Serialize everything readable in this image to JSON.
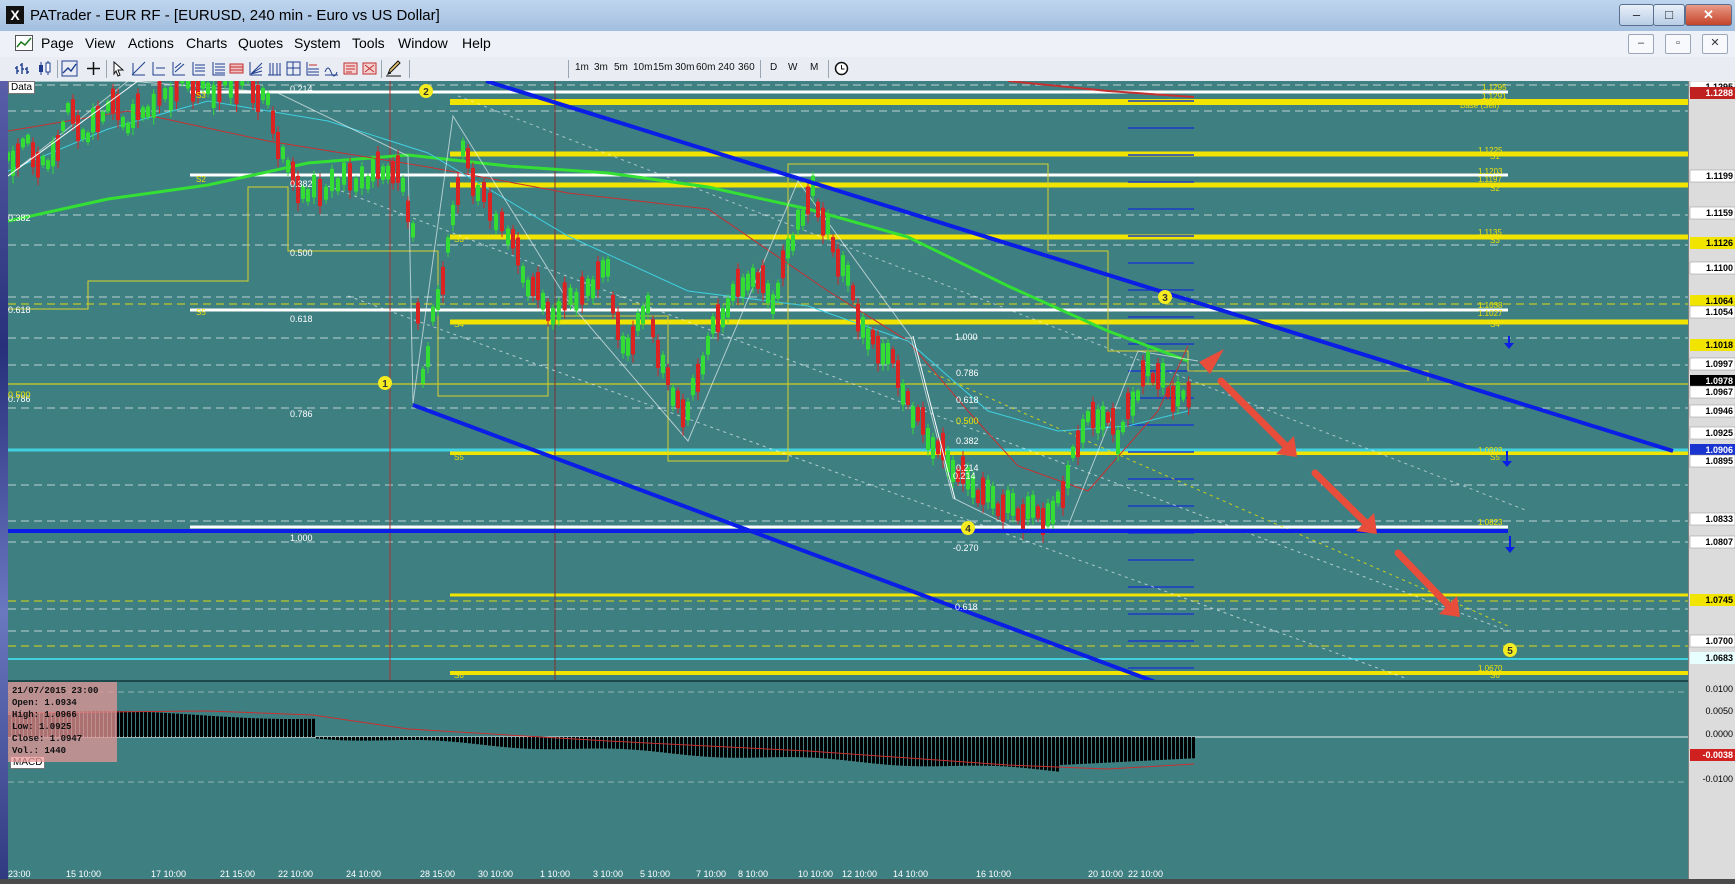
{
  "window": {
    "title": "PATrader - EUR RF - [EURUSD, 240 min - Euro vs US Dollar]",
    "app_icon": "X",
    "controls": [
      "–",
      "□",
      "✕"
    ]
  },
  "menu": {
    "items": [
      "Page",
      "View",
      "Actions",
      "Charts",
      "Quotes",
      "System",
      "Tools",
      "Window",
      "Help"
    ],
    "mdi_controls": [
      "–",
      "▫",
      "✕"
    ]
  },
  "toolbar": {
    "timeframes": [
      "1m",
      "3m",
      "5m",
      "10m",
      "15m",
      "30m",
      "60m",
      "240",
      "360",
      "D",
      "W",
      "M"
    ]
  },
  "chart": {
    "data_label": "Data",
    "macd_label": "MACD",
    "info_panel": {
      "date": "21/07/2015 23:00",
      "open": "Open: 1.0934",
      "high": "High: 1.0966",
      "low": "Low: 1.0925",
      "close": "Close: 1.0947",
      "vol": "Vol.: 1440"
    },
    "wave_labels": [
      "1",
      "2",
      "3",
      "4",
      "5"
    ],
    "fib_labels": [
      "0.214",
      "0.382",
      "0.500",
      "0.618",
      "0.786",
      "1.000",
      "0.618",
      "0.786",
      "0.500",
      "0.382",
      "0.214",
      "-0.270",
      "0.618",
      "1.000"
    ],
    "pivot_labels": [
      "S3",
      "S2",
      "S3",
      "S5",
      "S4",
      "S5",
      "S6",
      "S1",
      "S2",
      "S3",
      "S4",
      "S5",
      "S6"
    ],
    "level_labels": [
      "1.1295",
      "1.1291",
      "Base (Sell)",
      "1.1225",
      "1.1203",
      "1.1197",
      "1.1135",
      "1.1038",
      "1.1027",
      "1.0903",
      "1.0823",
      "1.0670"
    ],
    "price_axis": [
      "1.1295",
      "1.1288",
      "1.1199",
      "1.1159",
      "1.1126",
      "1.1100",
      "1.1064",
      "1.1054",
      "1.1018",
      "1.0997",
      "1.0978",
      "1.0967",
      "1.0946",
      "1.0925",
      "1.0906",
      "1.0895",
      "1.0833",
      "1.0807",
      "1.0745",
      "1.0700",
      "1.0683"
    ],
    "macd_axis": [
      "0.0100",
      "0.0050",
      "0.0000",
      "-0.0038",
      "-0.0100"
    ],
    "time_axis": [
      "23:00",
      "15 10:00",
      "17 10:00",
      "21 15:00",
      "22 10:00",
      "24 10:00",
      "28 15:00",
      "30 10:00",
      "1 10:00",
      "3 10:00",
      "5 10:00",
      "7 10:00",
      "8 10:00",
      "10 10:00",
      "12 10:00",
      "14 10:00",
      "16 10:00",
      "20 10:00",
      "22 10:00"
    ],
    "colors": {
      "background": "#3e7f82",
      "yellow_level": "#f0e400",
      "white_level": "#ffffff",
      "channel": "#0a1ee6",
      "ma_green": "#33e033",
      "ma_red": "#c83030",
      "ma_cyan": "#40d0e0",
      "arrow": "#e84c3a",
      "bull": "#33dd33",
      "bear": "#dd2222"
    }
  }
}
